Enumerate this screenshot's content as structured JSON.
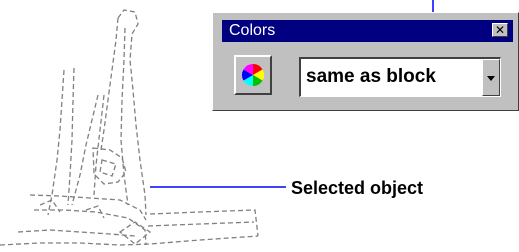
{
  "toolbar": {
    "title": "Colors",
    "close_glyph": "✕",
    "color_button_icon": "color-wheel-icon",
    "color_value": "same as block",
    "dropdown_icon": "chevron-down-icon"
  },
  "annotations": {
    "selected_object_label": "Selected object"
  },
  "colors": {
    "callout_line": "#0000ff",
    "titlebar": "#000080",
    "toolbar_face": "#c0c0c0",
    "sketch_stroke": "#808080"
  }
}
